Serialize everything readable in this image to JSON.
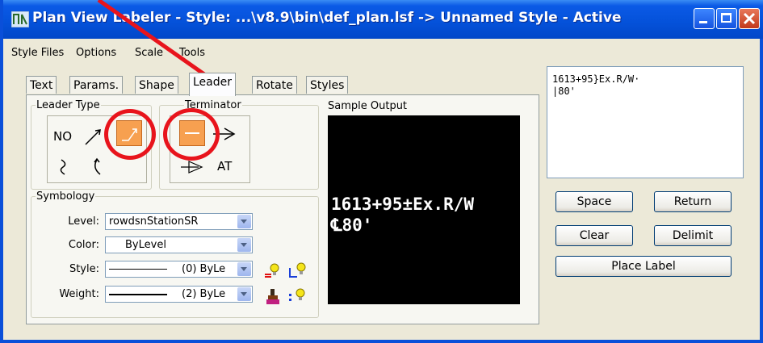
{
  "window": {
    "title": "Plan View Labeler - Style: ...\\v8.9\\bin\\def_plan.lsf -> Unnamed Style - Active"
  },
  "menu": [
    "Style Files",
    "Options",
    "Scale",
    "Tools"
  ],
  "tabs": [
    "Text",
    "Params.",
    "Shape",
    "Leader",
    "Rotate",
    "Styles"
  ],
  "active_tab": "Leader",
  "leader_type": {
    "title": "Leader Type",
    "none_label": "NO"
  },
  "terminator": {
    "title": "Terminator",
    "at_label": "AT"
  },
  "sample_output": {
    "label": "Sample Output",
    "line1": "1613+95±Ex.R/W",
    "line2": "℄80'"
  },
  "symbology": {
    "title": "Symbology",
    "level_label": "Level:",
    "level_value": "rowdsnStationSR",
    "color_label": "Color:",
    "color_value": "ByLevel",
    "style_label": "Style:",
    "style_value": "(0) ByLe",
    "weight_label": "Weight:",
    "weight_value": "(2) ByLe"
  },
  "preview_text": {
    "line1": "1613+95}Ex.R/W·",
    "line2": "|80'"
  },
  "buttons": {
    "space": "Space",
    "return": "Return",
    "clear": "Clear",
    "delimit": "Delimit",
    "place_label": "Place Label"
  },
  "colors": {
    "titlebar": "#0451d9",
    "selected_button": "#f7a050",
    "annotation": "#e8141c"
  }
}
